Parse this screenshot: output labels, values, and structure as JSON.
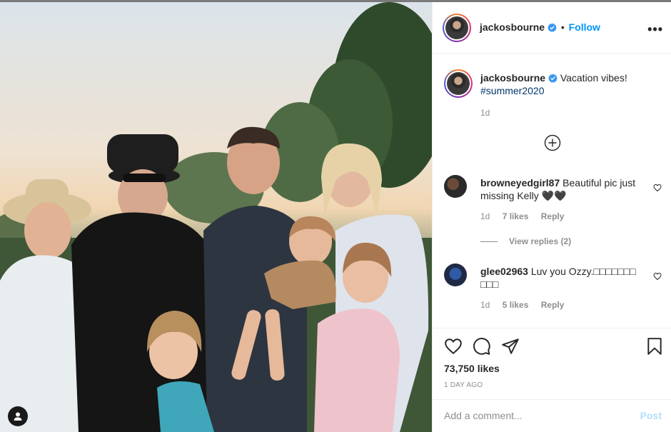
{
  "post": {
    "author": "jackosbourne",
    "follow_label": "Follow",
    "more_label": "•••"
  },
  "caption": {
    "username": "jackosbourne",
    "text": "Vacation vibes!",
    "hashtag": "#summer2020",
    "time": "1d"
  },
  "comments": [
    {
      "username": "browneyedgirl87",
      "text": "Beautiful pic just missing Kelly 🖤🖤",
      "time": "1d",
      "likes": "7 likes",
      "reply_label": "Reply",
      "view_replies": "View replies (2)"
    },
    {
      "username": "glee02963",
      "text": "Luv you Ozzy.□□□□□□□□□□",
      "time": "1d",
      "likes": "5 likes",
      "reply_label": "Reply"
    }
  ],
  "stats": {
    "likes": "73,750 likes",
    "posted": "1 DAY AGO"
  },
  "composer": {
    "placeholder": "Add a comment...",
    "post_label": "Post"
  },
  "colors": {
    "link_blue": "#0095f6",
    "muted": "#8e8e8e",
    "hashtag": "#00376b",
    "post_disabled": "#b2dffc"
  },
  "icons": {
    "verified": "verified-badge-icon",
    "more": "more-options-icon",
    "add": "add-circle-icon",
    "heart": "heart-icon",
    "comment": "comment-icon",
    "share": "share-icon",
    "save": "bookmark-icon",
    "user_tag": "user-tag-icon"
  }
}
